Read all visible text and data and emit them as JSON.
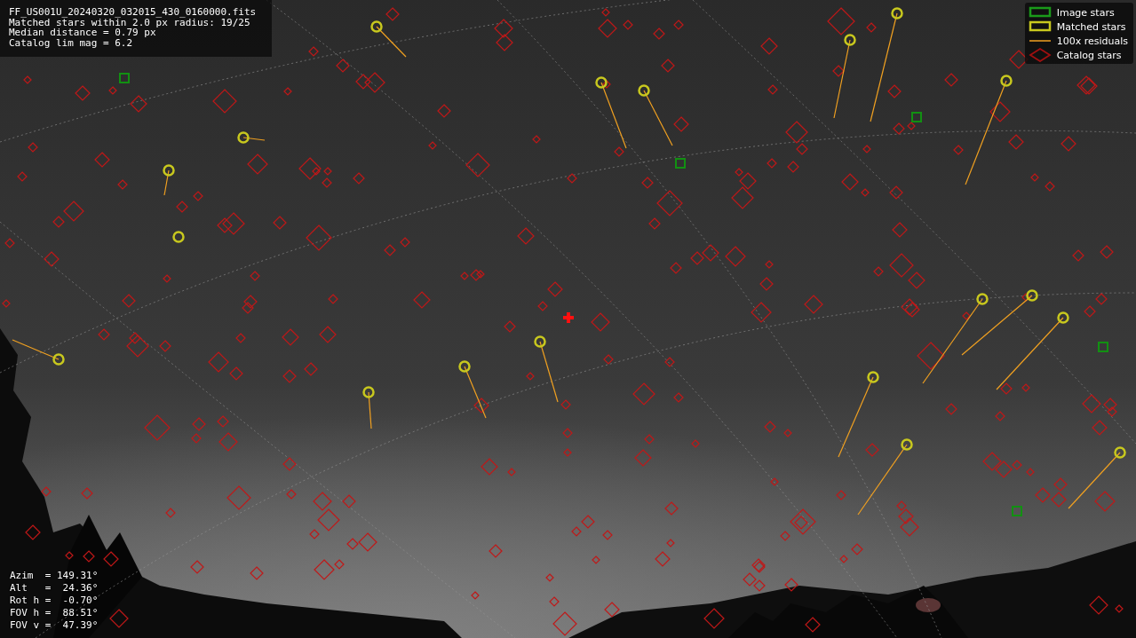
{
  "info_panel": {
    "lines": [
      "FF_US001U_20240320_032015_430_0160000.fits",
      "Matched stars within 2.0 px radius: 19/25",
      "Median distance = 0.79 px",
      "Catalog lim mag = 6.2"
    ]
  },
  "legend": {
    "items": [
      {
        "label": "Image stars"
      },
      {
        "kind": "matched",
        "label": "Matched stars"
      },
      {
        "kind": "residual",
        "label": "100x residuals"
      },
      {
        "kind": "catalog",
        "label": "Catalog stars"
      }
    ]
  },
  "readout": {
    "lines": [
      "Azim  = 149.31°",
      "Alt   =  24.36°",
      "Rot h =  -0.70°",
      "FOV h =  88.51°",
      "FOV v =  47.39°"
    ]
  }
}
